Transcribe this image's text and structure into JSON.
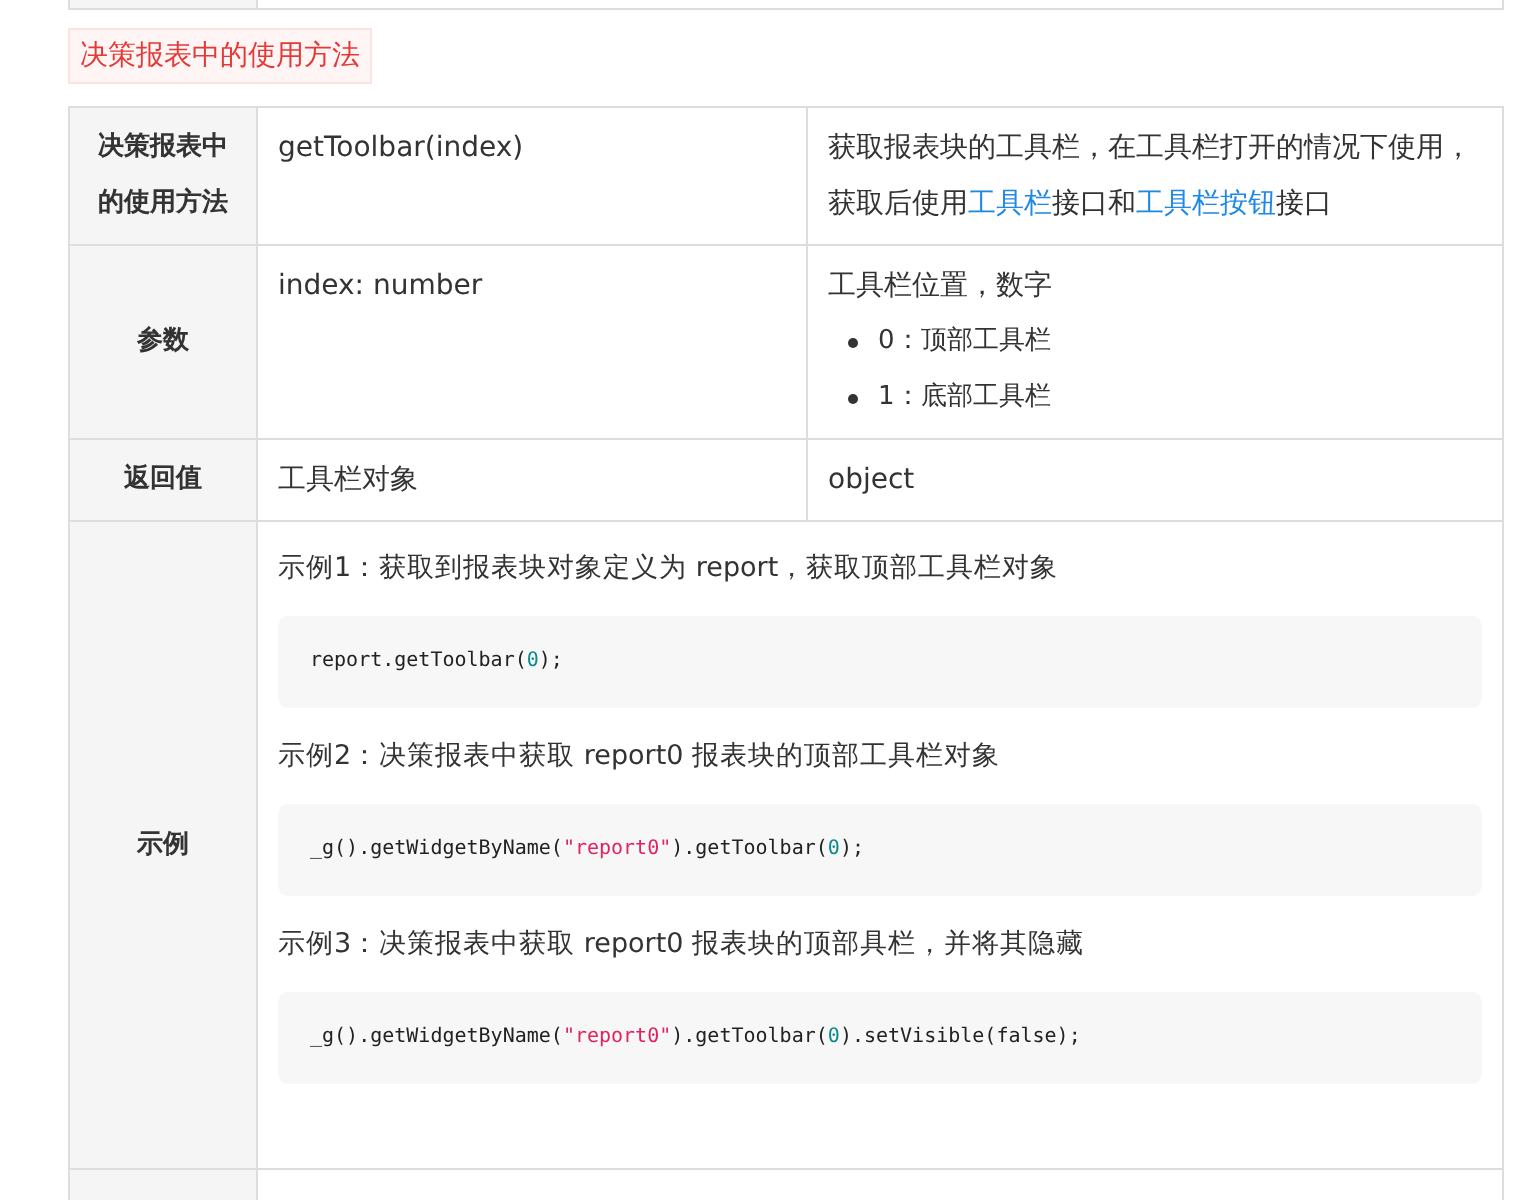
{
  "heading": "决策报表中的使用方法",
  "rows": [
    {
      "kind": "three",
      "label": "决策报表中的使用方法",
      "value": "getToolbar(index)",
      "description": {
        "text": [
          {
            "kind": "text",
            "text": "获取报表块的工具栏，在工具栏打开的情况下使用，获取后使用"
          },
          {
            "kind": "link",
            "text": "工具栏"
          },
          {
            "kind": "text",
            "text": "接口和"
          },
          {
            "kind": "link",
            "text": "工具栏按钮"
          },
          {
            "kind": "text",
            "text": "接口"
          }
        ]
      }
    },
    {
      "kind": "three",
      "label": "参数",
      "value": "index: number",
      "description": {
        "text": [
          {
            "kind": "text",
            "text": "工具栏位置，数字"
          }
        ],
        "bullets": [
          "0：顶部工具栏",
          "1：底部工具栏"
        ]
      }
    },
    {
      "kind": "three",
      "label": "返回值",
      "value": "工具栏对象",
      "description": {
        "text": [
          {
            "kind": "text",
            "text": "object"
          }
        ]
      }
    },
    {
      "kind": "examples",
      "label": "示例",
      "examples": [
        {
          "caption": "示例1：获取到报表块对象定义为 report，获取顶部工具栏对象",
          "code": [
            {
              "kind": "plain",
              "text": "report.getToolbar("
            },
            {
              "kind": "number",
              "text": "0"
            },
            {
              "kind": "plain",
              "text": ");"
            }
          ]
        },
        {
          "caption": "示例2：决策报表中获取 report0 报表块的顶部工具栏对象",
          "code": [
            {
              "kind": "plain",
              "text": "_g().getWidgetByName("
            },
            {
              "kind": "string",
              "text": "\"report0\""
            },
            {
              "kind": "plain",
              "text": ").getToolbar("
            },
            {
              "kind": "number",
              "text": "0"
            },
            {
              "kind": "plain",
              "text": ");"
            }
          ]
        },
        {
          "caption": "示例3：决策报表中获取 report0 报表块的顶部具栏，并将其隐藏",
          "code": [
            {
              "kind": "plain",
              "text": "_g().getWidgetByName("
            },
            {
              "kind": "string",
              "text": "\"report0\""
            },
            {
              "kind": "plain",
              "text": ").getToolbar("
            },
            {
              "kind": "number",
              "text": "0"
            },
            {
              "kind": "plain",
              "text": ").setVisible(false);"
            }
          ]
        }
      ]
    }
  ]
}
